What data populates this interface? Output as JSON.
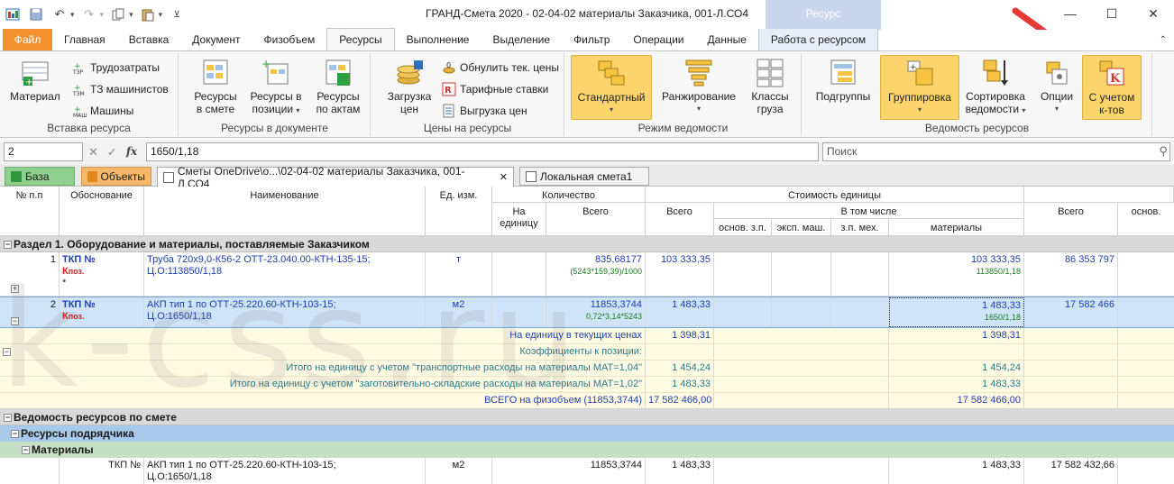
{
  "window": {
    "title": "ГРАНД-Смета 2020 - 02-04-02 материалы Заказчика, 001-Л.СО4",
    "context_tab": "Ресурс"
  },
  "tabs": [
    "Файл",
    "Главная",
    "Вставка",
    "Документ",
    "Физобъем",
    "Ресурсы",
    "Выполнение",
    "Выделение",
    "Фильтр",
    "Операции",
    "Данные",
    "Работа с ресурсом"
  ],
  "ribbon": {
    "g1": {
      "label": "Вставка ресурса",
      "material": "Материал",
      "labor": "Трудозатраты",
      "tzm": "ТЗ машинистов",
      "machines": "Машины"
    },
    "g2": {
      "label": "Ресурсы в документе",
      "b1a": "Ресурсы",
      "b1b": "в смете",
      "b2a": "Ресурсы в",
      "b2b": "позиции",
      "b3a": "Ресурсы",
      "b3b": "по актам"
    },
    "g3": {
      "label": "Цены на ресурсы",
      "loada": "Загрузка",
      "loadb": "цен",
      "reset": "Обнулить тек. цены",
      "tariff": "Тарифные ставки",
      "export": "Выгрузка цен"
    },
    "g4": {
      "label": "Режим ведомости",
      "standard": "Стандартный",
      "ranking": "Ранжирование",
      "classa": "Классы",
      "classb": "груза"
    },
    "g5": {
      "label": "Ведомость ресурсов",
      "subgroups": "Подгруппы",
      "grouping": "Группировка",
      "sorta": "Сортировка",
      "sortb": "ведомости",
      "options": "Опции",
      "coefa": "С учетом",
      "coefb": "к-тов"
    }
  },
  "formula": {
    "cell": "2",
    "value": "1650/1,18",
    "search_placeholder": "Поиск"
  },
  "doctabs": {
    "base": "База",
    "objects": "Объекты",
    "smeta": "Сметы OneDrive\\о...\\02-04-02 материалы Заказчика, 001-Л.СО4",
    "local": "Локальная смета1"
  },
  "headers": {
    "num": "№ п.п",
    "basis": "Обоснование",
    "name": "Наименование",
    "unit": "Ед. изм.",
    "qty": "Количество",
    "per_unit": "На единицу",
    "total": "Всего",
    "unit_cost": "Стоимость единицы",
    "cost_total": "Всего",
    "incl": "В том числе",
    "osn": "основ. з.п.",
    "eksp": "эксп. маш.",
    "zpm": "з.п. мех.",
    "mat": "материалы",
    "total2": "Всего",
    "osn2": "основ."
  },
  "section1": "Раздел 1. Оборудование и материалы, поставляемые Заказчиком",
  "rows": [
    {
      "num": "1",
      "code": "ТКП №",
      "k": "К",
      "kpos": "поз.",
      "star": "*",
      "name1": "Труба 720х9,0-К56-2 ОТТ-23.040.00-КТН-135-15;",
      "name2": "Ц.О:113850/1,18",
      "unit": "т",
      "qty": "835,68177",
      "qty_formula": "(5243*159,39)/1000",
      "cost": "103 333,35",
      "mat": "103 333,35",
      "mat_formula": "113850/1,18",
      "total": "86 353 797"
    },
    {
      "num": "2",
      "code": "ТКП №",
      "k": "К",
      "kpos": "поз.",
      "name1": "АКП тип 1 по ОТТ-25.220.60-КТН-103-15;",
      "name2": "Ц.О:1650/1,18",
      "unit": "м2",
      "qty": "11853,3744",
      "qty_formula": "0,72*3,14*5243",
      "cost": "1 483,33",
      "mat": "1 483,33",
      "mat_formula": "1650/1,18",
      "total": "17 582 466"
    }
  ],
  "details": [
    {
      "label": "На единицу в текущих ценах",
      "cost": "1 398,31",
      "mat": "1 398,31"
    },
    {
      "label": "Коэффициенты к позиции:",
      "cost": "",
      "mat": ""
    },
    {
      "label": "Итого на единицу с учетом \"транспортные расходы на материалы МАТ=1,04\"",
      "cost": "1 454,24",
      "mat": "1 454,24"
    },
    {
      "label": "Итого на единицу с учетом \"заготовительно-складские расходы на материалы МАТ=1,02\"",
      "cost": "1 483,33",
      "mat": "1 483,33"
    },
    {
      "label": "ВСЕГО на физобъем (11853,3744)",
      "cost": "17 582 466,00",
      "mat": "17 582 466,00"
    }
  ],
  "section2": "Ведомость ресурсов по смете",
  "section3": "Ресурсы подрядчика",
  "section4": "Материалы",
  "lastrow": {
    "code": "ТКП №",
    "name1": "АКП тип 1 по ОТТ-25.220.60-КТН-103-15;",
    "name2": "Ц.О:1650/1,18",
    "unit": "м2",
    "qty": "11853,3744",
    "cost": "1 483,33",
    "mat": "1 483,33",
    "total": "17 582 432,66"
  },
  "watermark": "k-css.ru",
  "colors": {
    "file_tab": "#f4902d",
    "selected_button": "#fbd56b",
    "section_blue": "#a9c9ec",
    "section_green": "#c6e0c6",
    "arrow": "#e53935"
  }
}
